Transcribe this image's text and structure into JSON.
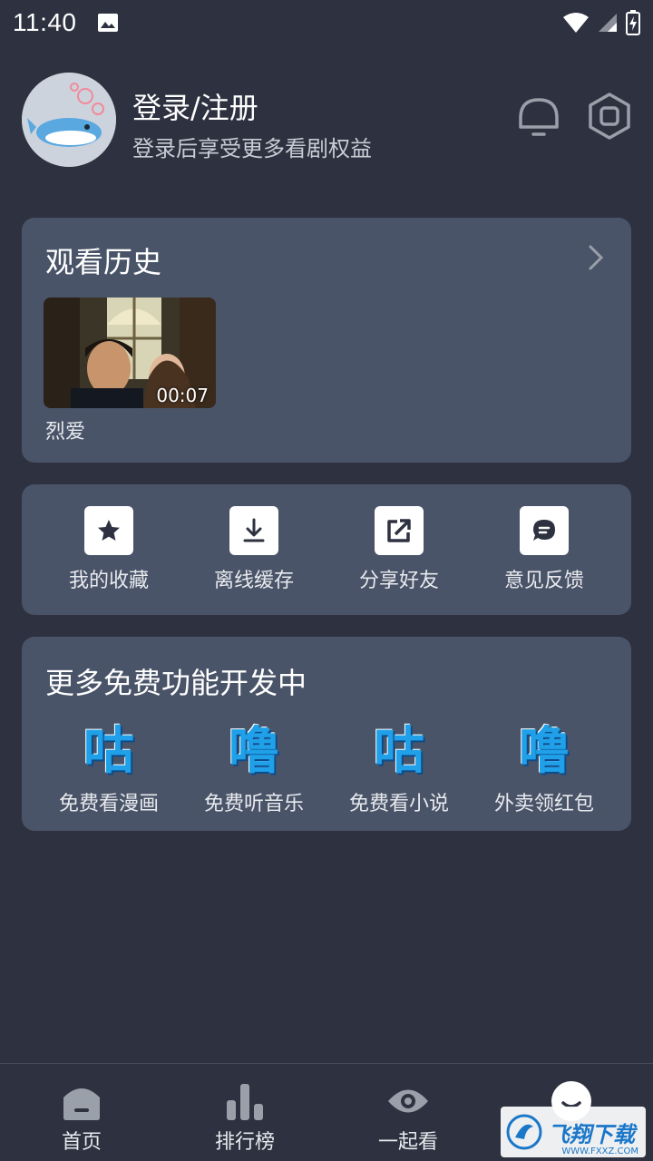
{
  "status_bar": {
    "time": "11:40"
  },
  "profile": {
    "title": "登录/注册",
    "subtitle": "登录后享受更多看剧权益"
  },
  "history": {
    "title": "观看历史",
    "items": [
      {
        "title": "烈爱",
        "time": "00:07"
      }
    ]
  },
  "actions": [
    {
      "label": "我的收藏",
      "icon": "star-icon"
    },
    {
      "label": "离线缓存",
      "icon": "download-icon"
    },
    {
      "label": "分享好友",
      "icon": "share-icon"
    },
    {
      "label": "意见反馈",
      "icon": "feedback-icon"
    }
  ],
  "more": {
    "title": "更多免费功能开发中",
    "features": [
      {
        "glyph": "咕",
        "label": "免费看漫画"
      },
      {
        "glyph": "噜",
        "label": "免费听音乐"
      },
      {
        "glyph": "咕",
        "label": "免费看小说"
      },
      {
        "glyph": "噜",
        "label": "外卖领红包"
      }
    ]
  },
  "nav": [
    {
      "label": "首页",
      "icon": "home-icon"
    },
    {
      "label": "排行榜",
      "icon": "chart-icon"
    },
    {
      "label": "一起看",
      "icon": "eye-icon"
    },
    {
      "label": "",
      "icon": "profile-icon"
    }
  ],
  "watermark": {
    "text": "飞翔下载",
    "sub": "WWW.FXXZ.COM"
  },
  "colors": {
    "background": "#2e3240",
    "card": "#4a5468",
    "accent": "#1fa0e8"
  }
}
